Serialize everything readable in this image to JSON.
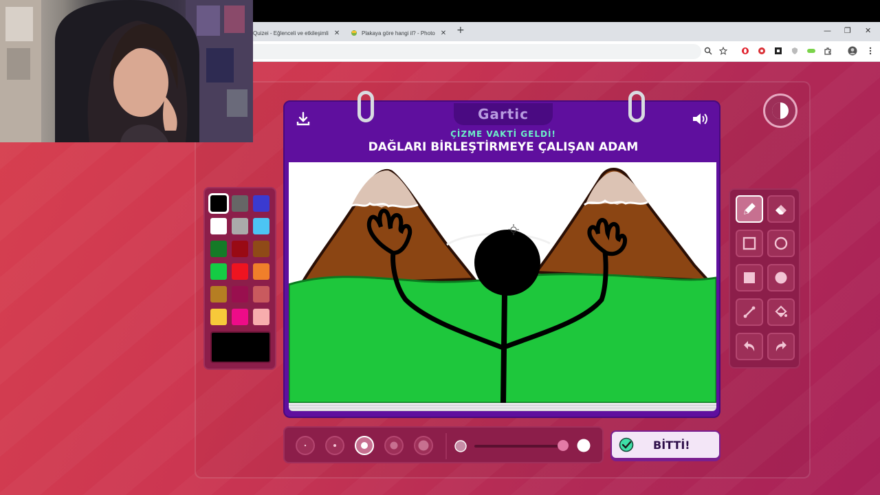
{
  "browser": {
    "tabs": [
      {
        "title": "Quizei - Eğlenceli ve etkileşimli",
        "close": "✕"
      },
      {
        "title": "Plakaya göre hangi il? - Photo",
        "close": "✕"
      }
    ],
    "new_tab": "+",
    "window_controls": {
      "minimize": "—",
      "maximize": "❐",
      "close": "✕"
    }
  },
  "game": {
    "logo": "Gartic",
    "subtitle": "ÇİZME VAKTİ GELDİ!",
    "title": "DAĞLARI BİRLEŞTİRMEYE ÇALIŞAN ADAM",
    "finish_label": "BİTTİ!",
    "palette": [
      "#000000",
      "#666666",
      "#3a3ad0",
      "#ffffff",
      "#aaaaaa",
      "#4cc4f4",
      "#157a27",
      "#990a14",
      "#8f4a17",
      "#14cc44",
      "#ee1420",
      "#f07f2a",
      "#b57e23",
      "#990f4e",
      "#c95a5e",
      "#f7c93a",
      "#ee0c88",
      "#f7adad"
    ],
    "selected_color": "#000000",
    "tools": [
      "pencil-icon",
      "eraser-icon",
      "rect-outline-icon",
      "circle-outline-icon",
      "rect-filled-icon",
      "circle-filled-icon",
      "line-icon",
      "fill-bucket-icon",
      "undo-icon",
      "redo-icon"
    ],
    "active_tool": "pencil-icon",
    "brush_sizes": 5,
    "active_size_index": 2,
    "opacity_level": 0.9
  }
}
